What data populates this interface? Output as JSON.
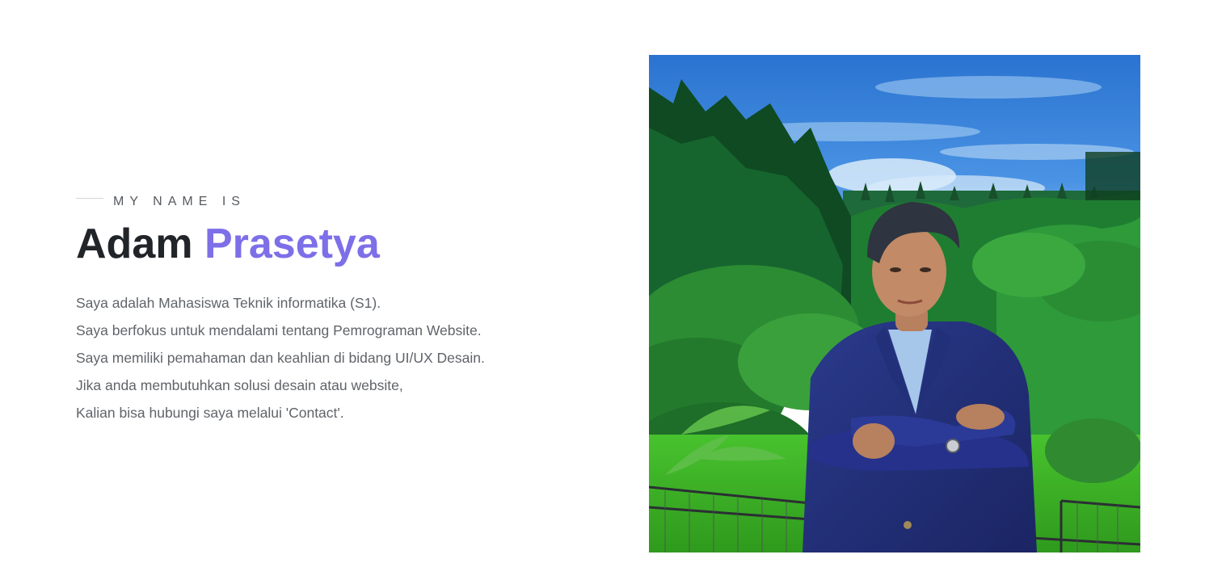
{
  "hero": {
    "eyebrow": "MY NAME IS",
    "name_first": "Adam",
    "name_last": "Prasetya",
    "bio_lines": [
      "Saya adalah Mahasiswa Teknik informatika (S1).",
      "Saya berfokus untuk mendalami tentang Pemrograman Website.",
      "Saya memiliki pemahaman dan keahlian di bidang UI/UX Desain.",
      "Jika anda membutuhkan solusi desain atau website,",
      "Kalian bisa hubungi saya melalui 'Contact'."
    ]
  },
  "colors": {
    "heading": "#212529",
    "accent": "#7d6fe8",
    "body_text": "#606469",
    "eyebrow_text": "#555a60"
  },
  "photo": {
    "subject": "profile-photo",
    "scene": [
      "sky",
      "forest",
      "lawn",
      "fence",
      "person-in-navy-jacket"
    ]
  }
}
